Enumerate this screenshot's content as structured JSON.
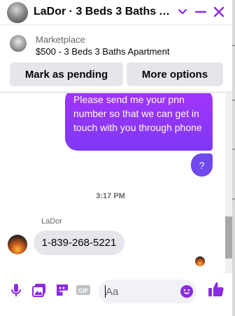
{
  "header": {
    "title": "LaDor · 3 Beds 3 Baths Ap...",
    "avatar_icon": "profile-photo"
  },
  "marketplace": {
    "label": "Marketplace",
    "item": "$500 - 3 Beds 3 Baths Apartment",
    "buttons": {
      "pending": "Mark as pending",
      "more": "More options"
    }
  },
  "messages": {
    "outgoing_text": "Please send me your pnn number so that we can get in touch with you through phone",
    "outgoing_question": "?",
    "timestamp": "3:17 PM",
    "sender_name": "LaDor",
    "incoming_text": "1-839-268-5221"
  },
  "composer": {
    "placeholder": "Aa"
  },
  "colors": {
    "accent": "#8a2be2",
    "bubble_out_top": "#a334fa",
    "bubble_out_bottom": "#7f38f5",
    "bubble_in": "#e4e6eb"
  },
  "icons": {
    "header": [
      "chevron-down-icon",
      "minimize-icon",
      "close-icon"
    ],
    "footer": [
      "microphone-icon",
      "photo-icon",
      "sticker-icon",
      "gif-icon",
      "emoji-icon",
      "thumbs-up-icon"
    ]
  }
}
